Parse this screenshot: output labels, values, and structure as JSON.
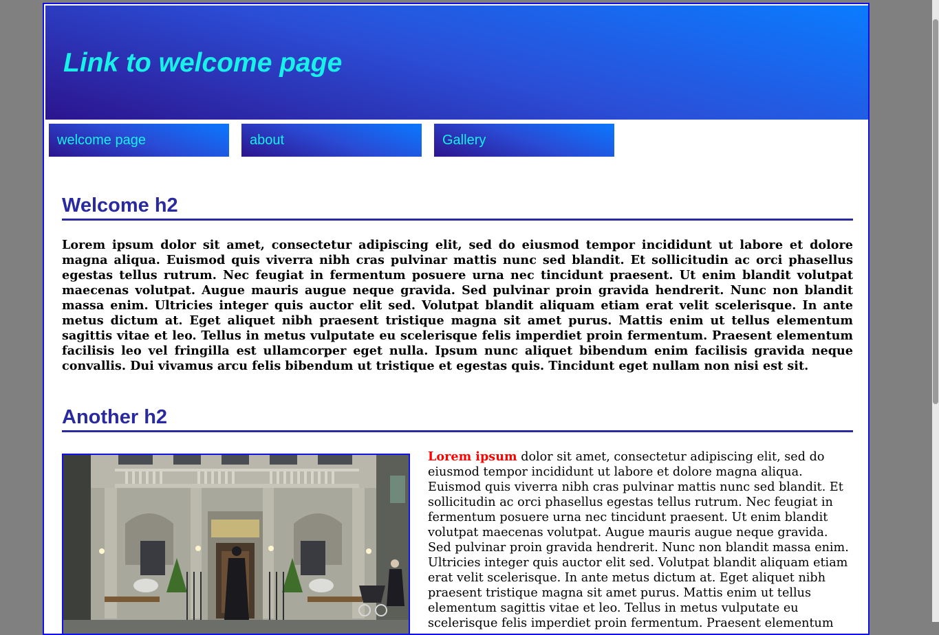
{
  "header": {
    "title": "Link to welcome page"
  },
  "nav": {
    "items": [
      {
        "label": "welcome page"
      },
      {
        "label": "about"
      },
      {
        "label": "Gallery"
      }
    ]
  },
  "main": {
    "section1": {
      "heading": "Welcome h2",
      "paragraph": "Lorem ipsum dolor sit amet, consectetur adipiscing elit, sed do eiusmod tempor incididunt ut labore et dolore magna aliqua. Euismod quis viverra nibh cras pulvinar mattis nunc sed blandit. Et sollicitudin ac orci phasellus egestas tellus rutrum. Nec feugiat in fermentum posuere urna nec tincidunt praesent. Ut enim blandit volutpat maecenas volutpat. Augue mauris augue neque gravida. Sed pulvinar proin gravida hendrerit. Nunc non blandit massa enim. Ultricies integer quis auctor elit sed. Volutpat blandit aliquam etiam erat velit scelerisque. In ante metus dictum at. Eget aliquet nibh praesent tristique magna sit amet purus. Mattis enim ut tellus elementum sagittis vitae et leo. Tellus in metus vulputate eu scelerisque felis imperdiet proin fermentum. Praesent elementum facilisis leo vel fringilla est ullamcorper eget nulla. Ipsum nunc aliquet bibendum enim facilisis gravida neque convallis. Dui vivamus arcu felis bibendum ut tristique et egestas quis. Tincidunt eget nullam non nisi est sit."
    },
    "section2": {
      "heading": "Another h2",
      "lead": "Lorem ipsum",
      "paragraph": " dolor sit amet, consectetur adipiscing elit, sed do eiusmod tempor incididunt ut labore et dolore magna aliqua. Euismod quis viverra nibh cras pulvinar mattis nunc sed blandit. Et sollicitudin ac orci phasellus egestas tellus rutrum. Nec feugiat in fermentum posuere urna nec tincidunt praesent. Ut enim blandit volutpat maecenas volutpat. Augue mauris augue neque gravida. Sed pulvinar proin gravida hendrerit. Nunc non blandit massa enim. Ultricies integer quis auctor elit sed. Volutpat blandit aliquam etiam erat velit scelerisque. In ante metus dictum at. Eget aliquet nibh praesent tristique magna sit amet purus. Mattis enim ut tellus elementum sagittis vitae et leo. Tellus in metus vulputate eu scelerisque felis imperdiet proin fermentum. Praesent elementum"
    }
  },
  "colors": {
    "page_background": "#808080",
    "border": "#1010e8",
    "header_gradient": [
      "#0a7cff",
      "#2c148e"
    ],
    "link_text": "#18f0e8",
    "heading": "#2a2aa0",
    "lead_text": "#ff0000"
  }
}
